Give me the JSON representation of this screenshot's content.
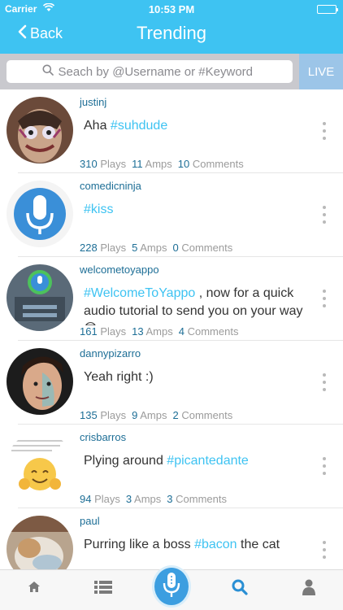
{
  "status_bar": {
    "carrier": "Carrier",
    "time": "10:53 PM"
  },
  "header": {
    "back_label": "Back",
    "title": "Trending"
  },
  "search": {
    "placeholder": "Seach by @Username or #Keyword",
    "live_label": "LIVE"
  },
  "posts": [
    {
      "username": "justinj",
      "caption_text": "Aha ",
      "caption_tag": "#suhdude",
      "caption_rest": "",
      "plays": "310",
      "amps": "11",
      "comments": "10",
      "avatar": "face-avatar-painted"
    },
    {
      "username": "comedicninja",
      "caption_text": "",
      "caption_tag": "#kiss",
      "caption_rest": "",
      "plays": "228",
      "amps": "5",
      "comments": "0",
      "avatar": "microphone-avatar"
    },
    {
      "username": "welcometoyappo",
      "caption_text": "",
      "caption_tag": "#WelcomeToYappo",
      "caption_rest": " , now for a quick audio tutorial to send you on your way😎",
      "plays": "161",
      "amps": "13",
      "comments": "4",
      "avatar": "app-screenshot-avatar"
    },
    {
      "username": "dannypizarro",
      "caption_text": "Yeah right :)",
      "caption_tag": "",
      "caption_rest": "",
      "plays": "135",
      "amps": "9",
      "comments": "2",
      "avatar": "face-avatar-blue"
    },
    {
      "username": "crisbarros",
      "caption_text": "Plying around ",
      "caption_tag": "#picantedante",
      "caption_rest": "",
      "plays": "94",
      "amps": "3",
      "comments": "3",
      "avatar": "emoji-avatar"
    },
    {
      "username": "paul",
      "caption_text": "Purring like a boss ",
      "caption_tag": "#bacon",
      "caption_rest": " the cat",
      "plays": "",
      "amps": "",
      "comments": "",
      "avatar": "cat-avatar"
    }
  ],
  "labels": {
    "plays": "Plays",
    "amps": "Amps",
    "comments": "Comments"
  },
  "tabbar": {
    "items": [
      "home-icon",
      "list-icon",
      "record-icon",
      "search-icon",
      "profile-icon"
    ],
    "active": "search-icon"
  },
  "colors": {
    "accent": "#3ec3f2",
    "username": "#1d6e96",
    "live": "#9cc5e8"
  }
}
